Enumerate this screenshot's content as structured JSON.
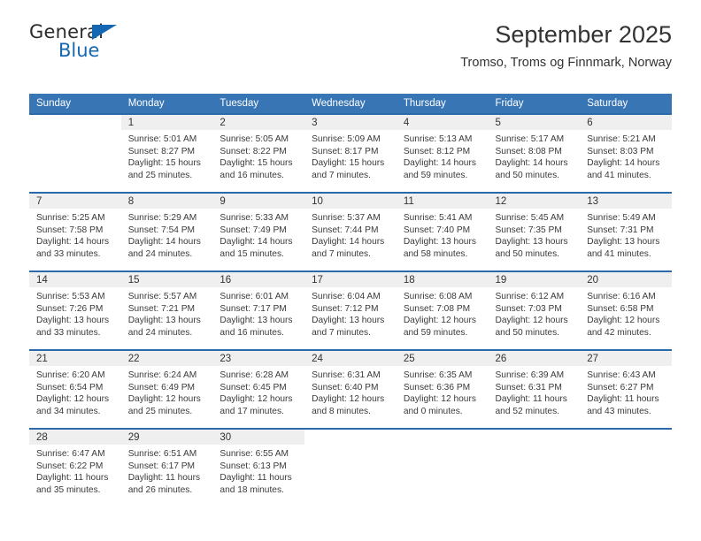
{
  "brand": {
    "name_top": "General",
    "name_bottom": "Blue",
    "accent_color": "#1567b2"
  },
  "header": {
    "month_title": "September 2025",
    "location": "Tromso, Troms og Finnmark, Norway"
  },
  "theme": {
    "header_row_bg": "#3875b4",
    "week_divider": "#2b6aa8",
    "daynum_bg": "#efefef"
  },
  "weekday_headers": [
    "Sunday",
    "Monday",
    "Tuesday",
    "Wednesday",
    "Thursday",
    "Friday",
    "Saturday"
  ],
  "labels": {
    "sunrise_prefix": "Sunrise:",
    "sunset_prefix": "Sunset:",
    "daylight_prefix": "Daylight:"
  },
  "weeks": [
    [
      {
        "day": "",
        "blank": true,
        "l1": "",
        "l2": "",
        "l3": "",
        "l4": ""
      },
      {
        "day": "1",
        "l1": "Sunrise: 5:01 AM",
        "l2": "Sunset: 8:27 PM",
        "l3": "Daylight: 15 hours",
        "l4": "and 25 minutes."
      },
      {
        "day": "2",
        "l1": "Sunrise: 5:05 AM",
        "l2": "Sunset: 8:22 PM",
        "l3": "Daylight: 15 hours",
        "l4": "and 16 minutes."
      },
      {
        "day": "3",
        "l1": "Sunrise: 5:09 AM",
        "l2": "Sunset: 8:17 PM",
        "l3": "Daylight: 15 hours",
        "l4": "and 7 minutes."
      },
      {
        "day": "4",
        "l1": "Sunrise: 5:13 AM",
        "l2": "Sunset: 8:12 PM",
        "l3": "Daylight: 14 hours",
        "l4": "and 59 minutes."
      },
      {
        "day": "5",
        "l1": "Sunrise: 5:17 AM",
        "l2": "Sunset: 8:08 PM",
        "l3": "Daylight: 14 hours",
        "l4": "and 50 minutes."
      },
      {
        "day": "6",
        "l1": "Sunrise: 5:21 AM",
        "l2": "Sunset: 8:03 PM",
        "l3": "Daylight: 14 hours",
        "l4": "and 41 minutes."
      }
    ],
    [
      {
        "day": "7",
        "l1": "Sunrise: 5:25 AM",
        "l2": "Sunset: 7:58 PM",
        "l3": "Daylight: 14 hours",
        "l4": "and 33 minutes."
      },
      {
        "day": "8",
        "l1": "Sunrise: 5:29 AM",
        "l2": "Sunset: 7:54 PM",
        "l3": "Daylight: 14 hours",
        "l4": "and 24 minutes."
      },
      {
        "day": "9",
        "l1": "Sunrise: 5:33 AM",
        "l2": "Sunset: 7:49 PM",
        "l3": "Daylight: 14 hours",
        "l4": "and 15 minutes."
      },
      {
        "day": "10",
        "l1": "Sunrise: 5:37 AM",
        "l2": "Sunset: 7:44 PM",
        "l3": "Daylight: 14 hours",
        "l4": "and 7 minutes."
      },
      {
        "day": "11",
        "l1": "Sunrise: 5:41 AM",
        "l2": "Sunset: 7:40 PM",
        "l3": "Daylight: 13 hours",
        "l4": "and 58 minutes."
      },
      {
        "day": "12",
        "l1": "Sunrise: 5:45 AM",
        "l2": "Sunset: 7:35 PM",
        "l3": "Daylight: 13 hours",
        "l4": "and 50 minutes."
      },
      {
        "day": "13",
        "l1": "Sunrise: 5:49 AM",
        "l2": "Sunset: 7:31 PM",
        "l3": "Daylight: 13 hours",
        "l4": "and 41 minutes."
      }
    ],
    [
      {
        "day": "14",
        "l1": "Sunrise: 5:53 AM",
        "l2": "Sunset: 7:26 PM",
        "l3": "Daylight: 13 hours",
        "l4": "and 33 minutes."
      },
      {
        "day": "15",
        "l1": "Sunrise: 5:57 AM",
        "l2": "Sunset: 7:21 PM",
        "l3": "Daylight: 13 hours",
        "l4": "and 24 minutes."
      },
      {
        "day": "16",
        "l1": "Sunrise: 6:01 AM",
        "l2": "Sunset: 7:17 PM",
        "l3": "Daylight: 13 hours",
        "l4": "and 16 minutes."
      },
      {
        "day": "17",
        "l1": "Sunrise: 6:04 AM",
        "l2": "Sunset: 7:12 PM",
        "l3": "Daylight: 13 hours",
        "l4": "and 7 minutes."
      },
      {
        "day": "18",
        "l1": "Sunrise: 6:08 AM",
        "l2": "Sunset: 7:08 PM",
        "l3": "Daylight: 12 hours",
        "l4": "and 59 minutes."
      },
      {
        "day": "19",
        "l1": "Sunrise: 6:12 AM",
        "l2": "Sunset: 7:03 PM",
        "l3": "Daylight: 12 hours",
        "l4": "and 50 minutes."
      },
      {
        "day": "20",
        "l1": "Sunrise: 6:16 AM",
        "l2": "Sunset: 6:58 PM",
        "l3": "Daylight: 12 hours",
        "l4": "and 42 minutes."
      }
    ],
    [
      {
        "day": "21",
        "l1": "Sunrise: 6:20 AM",
        "l2": "Sunset: 6:54 PM",
        "l3": "Daylight: 12 hours",
        "l4": "and 34 minutes."
      },
      {
        "day": "22",
        "l1": "Sunrise: 6:24 AM",
        "l2": "Sunset: 6:49 PM",
        "l3": "Daylight: 12 hours",
        "l4": "and 25 minutes."
      },
      {
        "day": "23",
        "l1": "Sunrise: 6:28 AM",
        "l2": "Sunset: 6:45 PM",
        "l3": "Daylight: 12 hours",
        "l4": "and 17 minutes."
      },
      {
        "day": "24",
        "l1": "Sunrise: 6:31 AM",
        "l2": "Sunset: 6:40 PM",
        "l3": "Daylight: 12 hours",
        "l4": "and 8 minutes."
      },
      {
        "day": "25",
        "l1": "Sunrise: 6:35 AM",
        "l2": "Sunset: 6:36 PM",
        "l3": "Daylight: 12 hours",
        "l4": "and 0 minutes."
      },
      {
        "day": "26",
        "l1": "Sunrise: 6:39 AM",
        "l2": "Sunset: 6:31 PM",
        "l3": "Daylight: 11 hours",
        "l4": "and 52 minutes."
      },
      {
        "day": "27",
        "l1": "Sunrise: 6:43 AM",
        "l2": "Sunset: 6:27 PM",
        "l3": "Daylight: 11 hours",
        "l4": "and 43 minutes."
      }
    ],
    [
      {
        "day": "28",
        "l1": "Sunrise: 6:47 AM",
        "l2": "Sunset: 6:22 PM",
        "l3": "Daylight: 11 hours",
        "l4": "and 35 minutes."
      },
      {
        "day": "29",
        "l1": "Sunrise: 6:51 AM",
        "l2": "Sunset: 6:17 PM",
        "l3": "Daylight: 11 hours",
        "l4": "and 26 minutes."
      },
      {
        "day": "30",
        "l1": "Sunrise: 6:55 AM",
        "l2": "Sunset: 6:13 PM",
        "l3": "Daylight: 11 hours",
        "l4": "and 18 minutes."
      },
      {
        "day": "",
        "blank": true,
        "l1": "",
        "l2": "",
        "l3": "",
        "l4": ""
      },
      {
        "day": "",
        "blank": true,
        "l1": "",
        "l2": "",
        "l3": "",
        "l4": ""
      },
      {
        "day": "",
        "blank": true,
        "l1": "",
        "l2": "",
        "l3": "",
        "l4": ""
      },
      {
        "day": "",
        "blank": true,
        "l1": "",
        "l2": "",
        "l3": "",
        "l4": ""
      }
    ]
  ]
}
